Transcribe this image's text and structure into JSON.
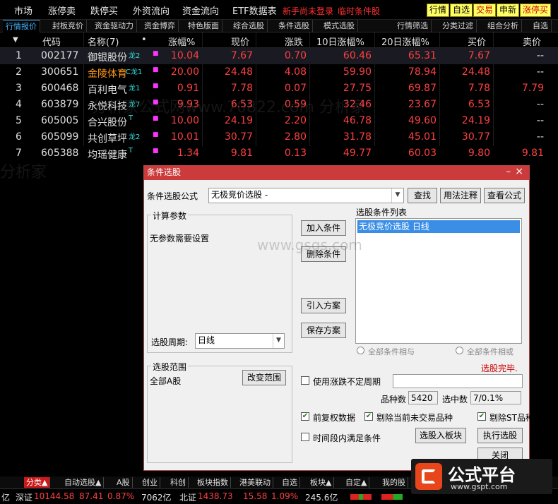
{
  "menubar": {
    "items": [
      "市场",
      "涨停卖",
      "跌停买",
      "外资流向",
      "资金流向",
      "ETF数据表"
    ],
    "alert1": "新手尚未登录",
    "alert2": "临时条件股",
    "buttons": [
      "行情",
      "自选",
      "交易",
      "申新",
      "涨停买"
    ]
  },
  "tabs": [
    "行情报价",
    "封板竞价",
    "资金驱动力",
    "资金博弈",
    "特色版面",
    "综合选股",
    "条件选股",
    "模式选股",
    "行情筛选",
    "分类过滤",
    "组合分析",
    "自选"
  ],
  "table": {
    "headers": [
      "代码",
      "名称(7)",
      "•",
      "涨幅%",
      "现价",
      "涨跌",
      "10日涨幅%",
      "20日涨幅%",
      "买价",
      "卖价"
    ],
    "rows": [
      {
        "idx": "1",
        "code": "002177",
        "name": "御银股份",
        "tag": "龙2",
        "chg": "10.04",
        "price": "7.67",
        "diff": "0.70",
        "d10": "60.46",
        "d20": "65.31",
        "bid": "7.67",
        "ask": "--"
      },
      {
        "idx": "2",
        "code": "300651",
        "name": "金陵体育",
        "tag": "C龙1",
        "chg": "20.00",
        "price": "24.48",
        "diff": "4.08",
        "d10": "59.90",
        "d20": "78.94",
        "bid": "24.48",
        "ask": "--"
      },
      {
        "idx": "3",
        "code": "600468",
        "name": "百利电气",
        "tag": "龙1",
        "chg": "0.91",
        "price": "7.78",
        "diff": "0.07",
        "d10": "27.75",
        "d20": "69.87",
        "bid": "7.78",
        "ask": "7.79"
      },
      {
        "idx": "4",
        "code": "603879",
        "name": "永悦科技",
        "tag": "龙7",
        "chg": "9.93",
        "price": "6.53",
        "diff": "0.59",
        "d10": "32.46",
        "d20": "23.67",
        "bid": "6.53",
        "ask": "--"
      },
      {
        "idx": "5",
        "code": "605005",
        "name": "合兴股份",
        "tag": "T",
        "chg": "10.00",
        "price": "24.19",
        "diff": "2.20",
        "d10": "46.78",
        "d20": "49.60",
        "bid": "24.19",
        "ask": "--"
      },
      {
        "idx": "6",
        "code": "605099",
        "name": "共创草坪",
        "tag": "龙2",
        "chg": "10.01",
        "price": "30.77",
        "diff": "2.80",
        "d10": "31.78",
        "d20": "45.01",
        "bid": "30.77",
        "ask": "--"
      },
      {
        "idx": "7",
        "code": "605388",
        "name": "均瑶健康",
        "tag": "T",
        "chg": "1.34",
        "price": "9.81",
        "diff": "0.13",
        "d10": "49.77",
        "d20": "60.03",
        "bid": "9.80",
        "ask": "9.81"
      }
    ]
  },
  "dialog": {
    "title": "条件选股",
    "formula_label": "条件选股公式",
    "formula_value": "无极竞价选股 -",
    "btn_find": "查找",
    "btn_usage": "用法注释",
    "btn_view": "查看公式",
    "calc_label": "计算参数",
    "no_params": "无参数需要设置",
    "period_label": "选股周期:",
    "period_value": "日线",
    "btn_add": "加入条件",
    "btn_del": "删除条件",
    "btn_import": "引入方案",
    "btn_save": "保存方案",
    "list_label": "选股条件列表",
    "list_item": "无极竞价选股  日线",
    "radio_and": "全部条件相与",
    "radio_or": "全部条件相或",
    "done": "选股完毕.",
    "range_label": "选股范围",
    "range_value": "全部A股",
    "btn_range": "改变范围",
    "cb_uncertain": "使用涨跌不定周期",
    "count_label": "品种数",
    "count_value": "5420",
    "hit_label": "选中数",
    "hit_value": "7/0.1%",
    "cb_fq": "前复权数据",
    "cb_notrade": "剔除当前未交易品种",
    "cb_st": "剔除ST品种",
    "cb_time": "时间段内满足条件",
    "btn_toblock": "选股入板块",
    "btn_exec": "执行选股",
    "btn_close": "关闭"
  },
  "bottom_tabs": [
    "分类▲",
    "自动选股▲",
    "A股",
    "创业",
    "科创",
    "板块指数",
    "港美联动",
    "自选",
    "板块▲",
    "自定▲",
    "我的股"
  ],
  "status": {
    "s1": "亿",
    "sz_label": "深证",
    "sz_val": "10144.58",
    "sz_chg": "87.41",
    "sz_pct": "0.87%",
    "sz_amt": "7062亿",
    "bz_label": "北证",
    "bz_val": "1438.73",
    "bz_chg": "15.58",
    "bz_pct": "1.09%",
    "bz_amt": "245.6亿"
  },
  "watermarks": {
    "site": "www.gsgs.com",
    "logo_text": "公式平台",
    "logo_url": "www.gspt.com"
  },
  "colors": {
    "up": "#ff4040",
    "accent": "#46b6ff",
    "dialog_title": "#cc3b3b"
  }
}
